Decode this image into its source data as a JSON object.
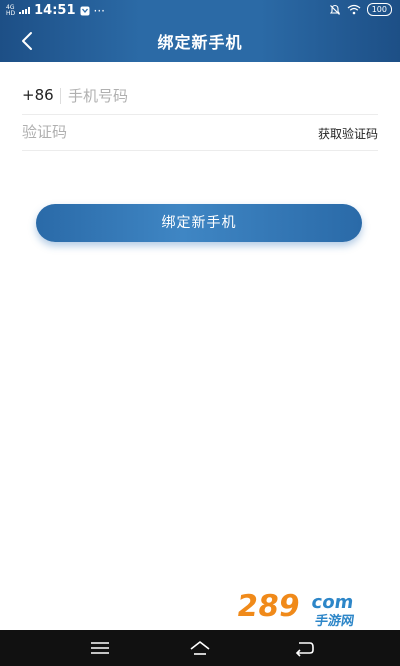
{
  "status_bar": {
    "network": "4G",
    "network_sub": "HD",
    "time": "14:51",
    "more": "···",
    "battery": "100"
  },
  "header": {
    "title": "绑定新手机"
  },
  "form": {
    "country_code": "+86",
    "phone_placeholder": "手机号码",
    "code_placeholder": "验证码",
    "get_code_label": "获取验证码"
  },
  "primary_button": {
    "label": "绑定新手机"
  },
  "watermark": {
    "brand_number": "289",
    "brand_suffix": "com",
    "brand_sub": "手游网"
  },
  "colors": {
    "header_bg": "#2b6aa6",
    "button_bg": "#3f86c4",
    "watermark": "#f08a1a",
    "nav_bar": "#111111"
  }
}
